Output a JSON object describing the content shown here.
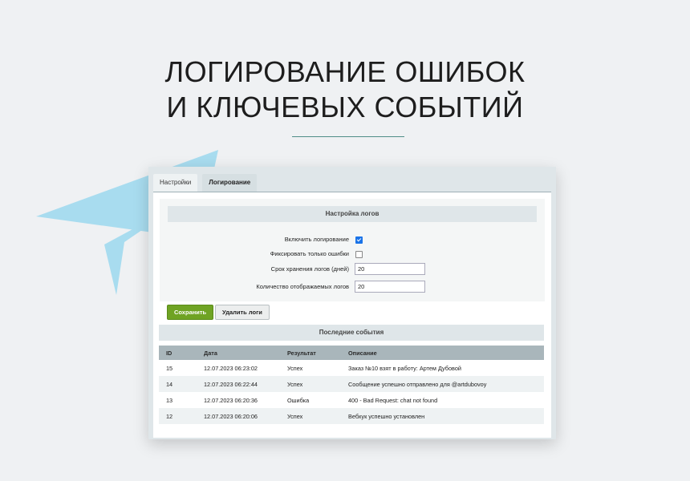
{
  "hero": {
    "title_line1": "ЛОГИРОВАНИЕ ОШИБОК",
    "title_line2": "И КЛЮЧЕВЫХ СОБЫТИЙ"
  },
  "colors": {
    "accent": "#6fa323",
    "divider": "#4f8d87",
    "plane": "#a8dcef"
  },
  "icons": {
    "decor": "telegram-plane-icon"
  },
  "tabs": [
    {
      "label": "Настройки",
      "active": false
    },
    {
      "label": "Логирование",
      "active": true
    }
  ],
  "settings": {
    "header": "Настройка логов",
    "enable_logging": {
      "label": "Включить логирование",
      "checked": true
    },
    "errors_only": {
      "label": "Фиксировать только ошибки",
      "checked": false
    },
    "retention": {
      "label": "Срок хранения логов (дней)",
      "value": "20"
    },
    "display_count": {
      "label": "Количество отображаемых логов",
      "value": "20"
    }
  },
  "buttons": {
    "save": "Сохранить",
    "delete": "Удалить логи"
  },
  "events": {
    "header": "Последние события",
    "columns": [
      "ID",
      "Дата",
      "Результат",
      "Описание"
    ],
    "rows": [
      [
        "15",
        "12.07.2023 06:23:02",
        "Успех",
        "Заказ №10 взят в работу: Артем Дубовой"
      ],
      [
        "14",
        "12.07.2023 06:22:44",
        "Успех",
        "Сообщение успешно отправлено для @artdubovoy"
      ],
      [
        "13",
        "12.07.2023 06:20:36",
        "Ошибка",
        "400 - Bad Request: chat not found"
      ],
      [
        "12",
        "12.07.2023 06:20:06",
        "Успех",
        "Вебхук успешно установлен"
      ]
    ]
  }
}
